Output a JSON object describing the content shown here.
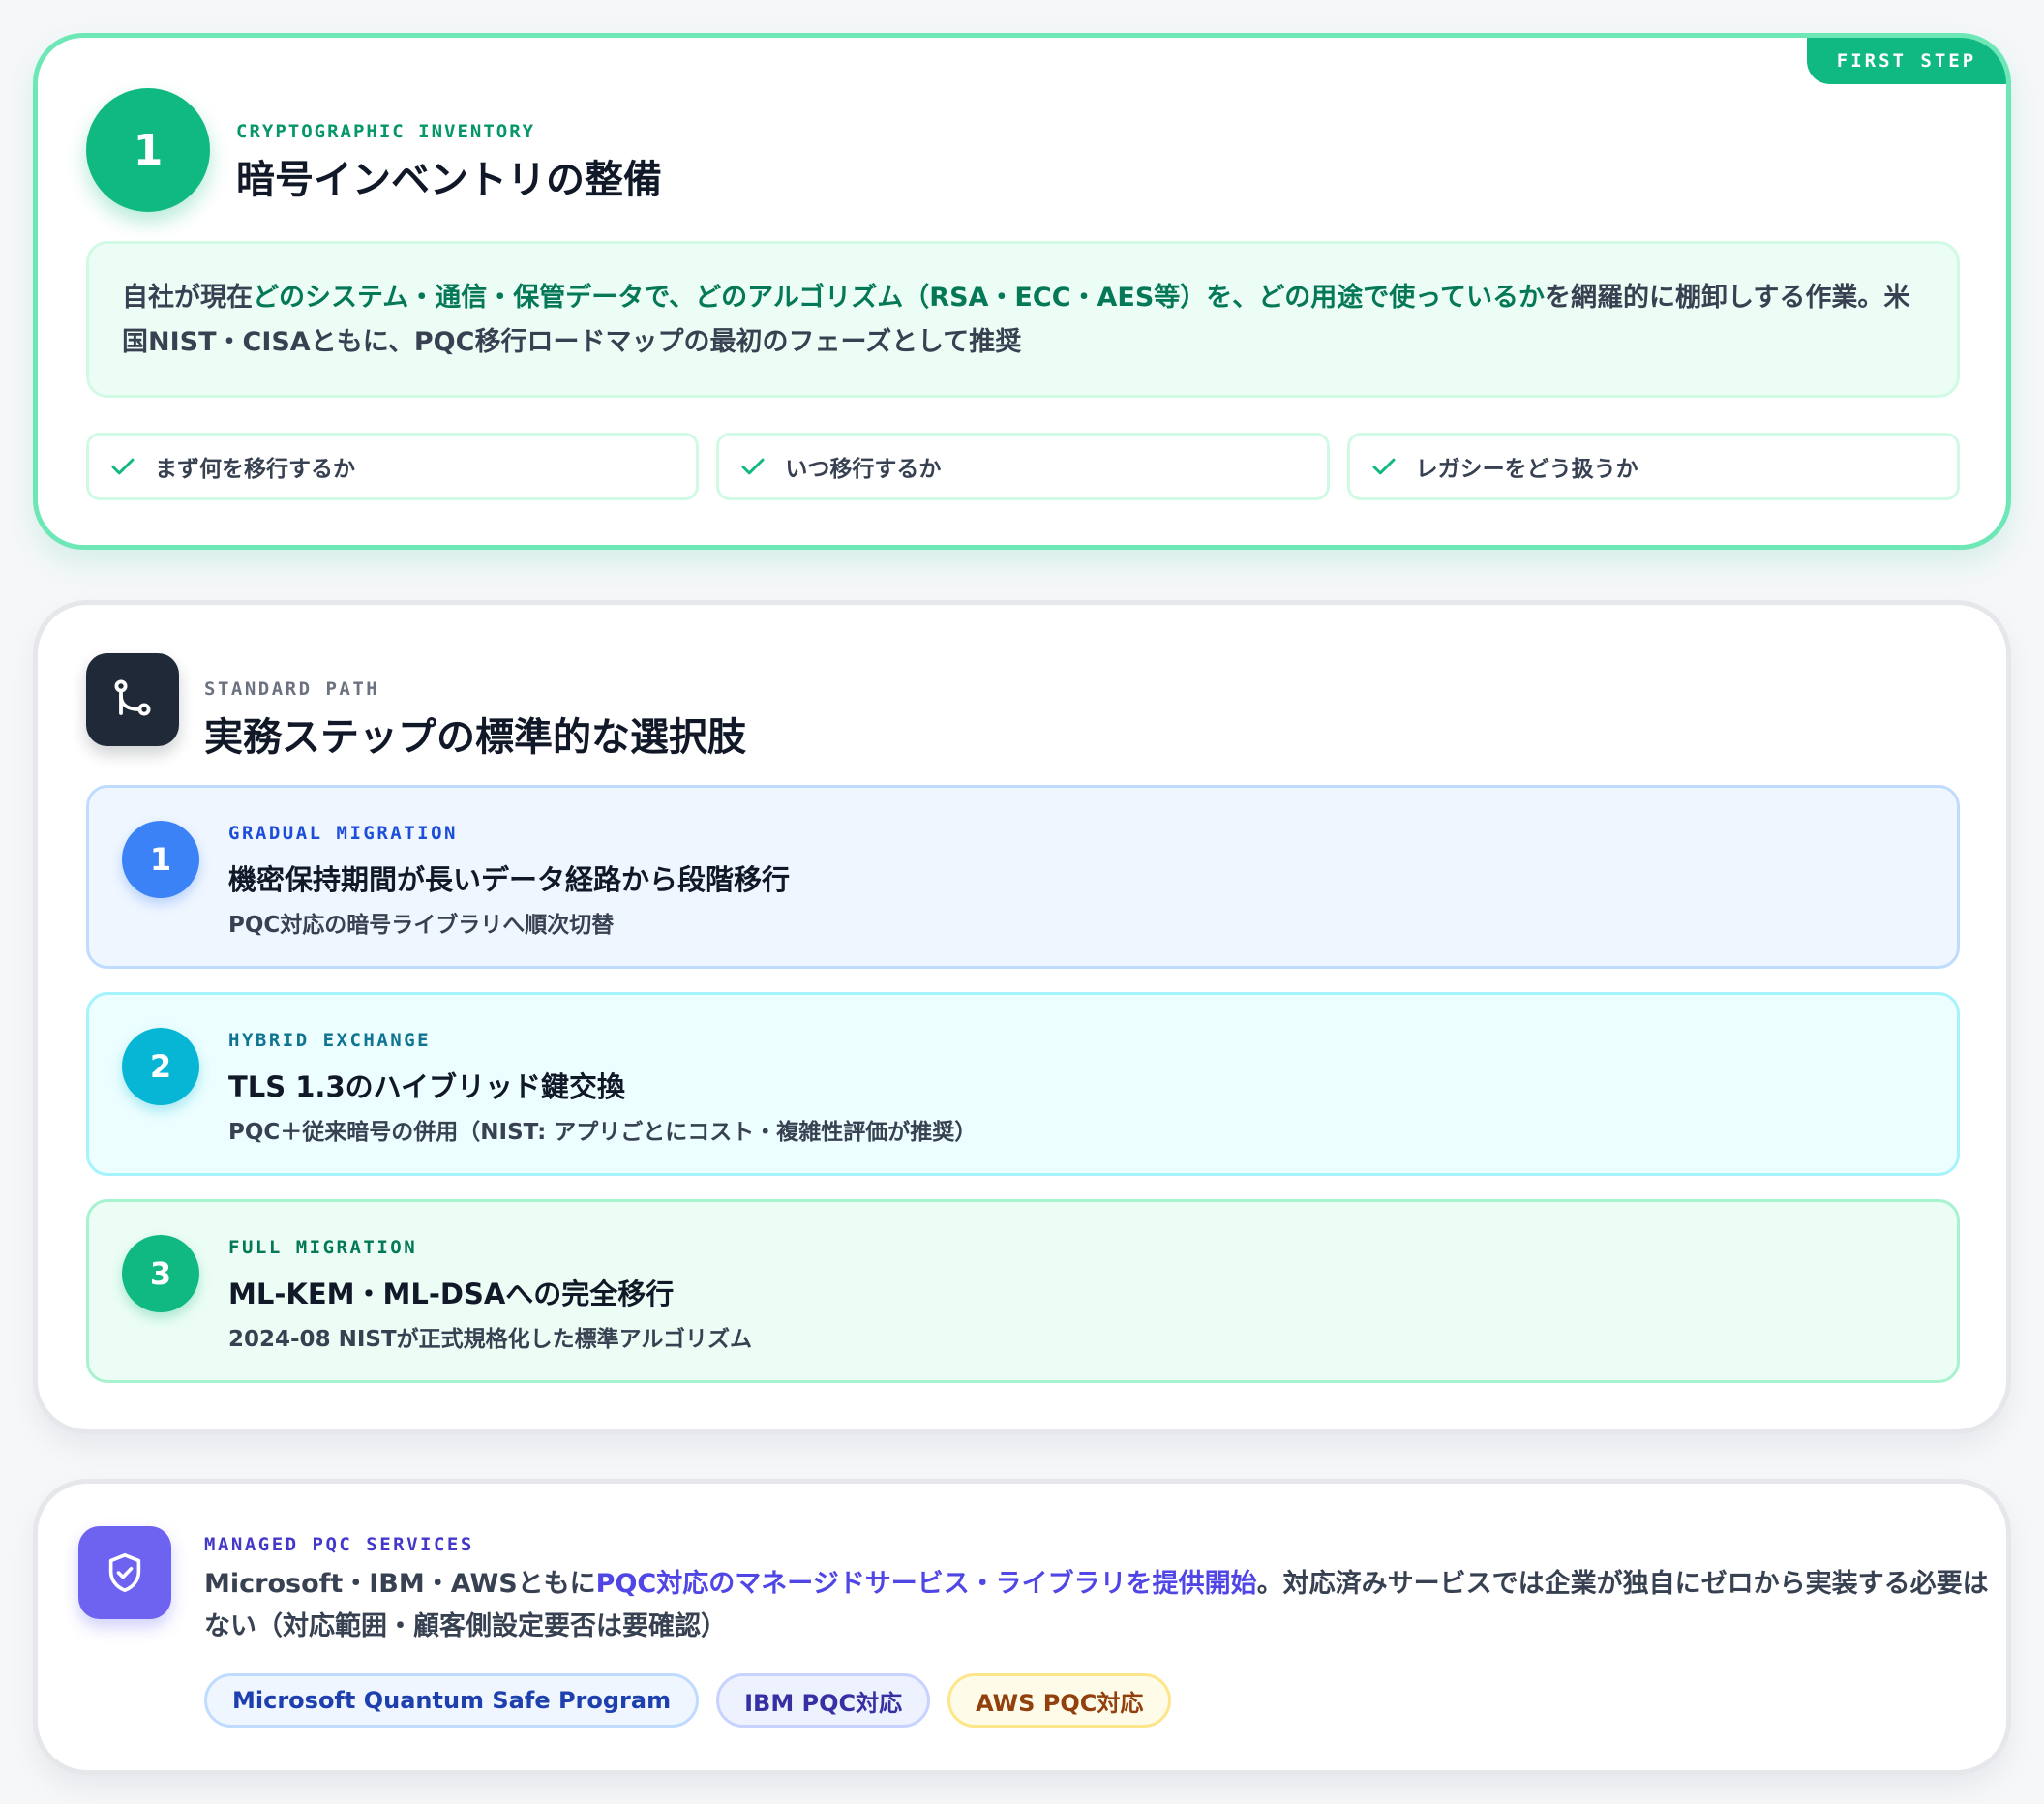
{
  "inventory": {
    "badge": "FIRST STEP",
    "number": "1",
    "eyebrow": "CRYPTOGRAPHIC INVENTORY",
    "title": "暗号インベントリの整備",
    "desc": {
      "p1": "自社が現在",
      "h1": "どのシステム・通信・保管データで、どのアルゴリズム（RSA・ECC・AES等）を、どの用途で使っているか",
      "p2": "を網羅的に棚卸しする作業。米国NIST・CISAともに、PQC移行ロードマップの最初のフェーズとして推奨"
    },
    "checks": [
      "まず何を移行するか",
      "いつ移行するか",
      "レガシーをどう扱うか"
    ]
  },
  "standard_path": {
    "eyebrow": "STANDARD PATH",
    "title": "実務ステップの標準的な選択肢",
    "steps": [
      {
        "number": "1",
        "key": "GRADUAL MIGRATION",
        "title": "機密保持期間が長いデータ経路から段階移行",
        "sub": "PQC対応の暗号ライブラリへ順次切替"
      },
      {
        "number": "2",
        "key": "HYBRID EXCHANGE",
        "title": "TLS 1.3のハイブリッド鍵交換",
        "sub": "PQC＋従来暗号の併用（NIST: アプリごとにコスト・複雑性評価が推奨）"
      },
      {
        "number": "3",
        "key": "FULL MIGRATION",
        "title": "ML-KEM・ML-DSAへの完全移行",
        "sub": "2024-08 NISTが正式規格化した標準アルゴリズム"
      }
    ]
  },
  "managed": {
    "eyebrow": "MANAGED PQC SERVICES",
    "body": {
      "p1": "Microsoft・IBM・AWSともに",
      "h1": "PQC対応のマネージドサービス・ライブラリを提供開始",
      "p2": "。対応済みサービスでは企業が独自にゼロから実装する必要はない（対応範囲・顧客側設定要否は要確認）"
    },
    "tags": [
      "Microsoft Quantum Safe Program",
      "IBM PQC対応",
      "AWS PQC対応"
    ]
  },
  "icons": {
    "check": "check-icon",
    "branch": "git-branch-icon",
    "shield": "shield-check-icon"
  },
  "colors": {
    "green": "#10b981",
    "blue": "#3b82f6",
    "cyan": "#06b6d4",
    "indigo": "#6d63f0",
    "dark": "#1f2937"
  }
}
